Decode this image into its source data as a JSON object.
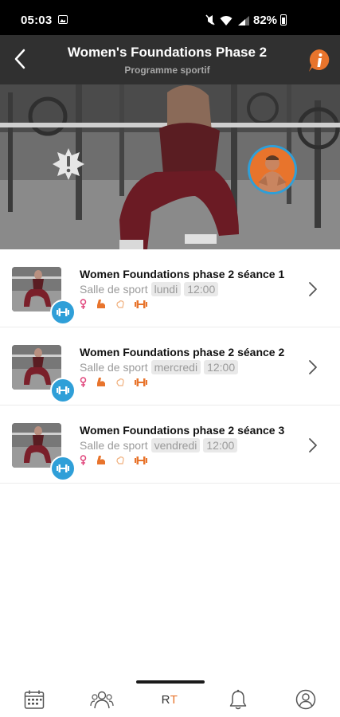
{
  "status_bar": {
    "time": "05:03",
    "battery": "82%"
  },
  "header": {
    "title": "Women's Foundations Phase 2",
    "subtitle": "Programme sportif",
    "info_icon": "info-icon",
    "back_icon": "back-arrow-icon"
  },
  "colors": {
    "accent_orange": "#e8742c",
    "accent_blue": "#2f9fd8",
    "header_bg": "#303030",
    "female_icon": "#e0457b",
    "chip_bg": "#e9e9e9"
  },
  "sessions": [
    {
      "title": "Women Foundations phase 2 séance 1",
      "location": "Salle de sport",
      "day": "lundi",
      "time": "12:00"
    },
    {
      "title": "Women Foundations phase 2 séance 2",
      "location": "Salle de sport",
      "day": "mercredi",
      "time": "12:00"
    },
    {
      "title": "Women Foundations phase 2 séance 3",
      "location": "Salle de sport",
      "day": "vendredi",
      "time": "12:00"
    }
  ],
  "session_icons": [
    "female-icon",
    "arm-muscle-icon",
    "hand-icon",
    "dumbbell-icon"
  ],
  "bottom_nav": {
    "items": [
      "calendar-icon",
      "group-icon",
      "rt-logo",
      "bell-icon",
      "profile-icon"
    ],
    "rt_label_r": "R",
    "rt_label_t": "T"
  }
}
